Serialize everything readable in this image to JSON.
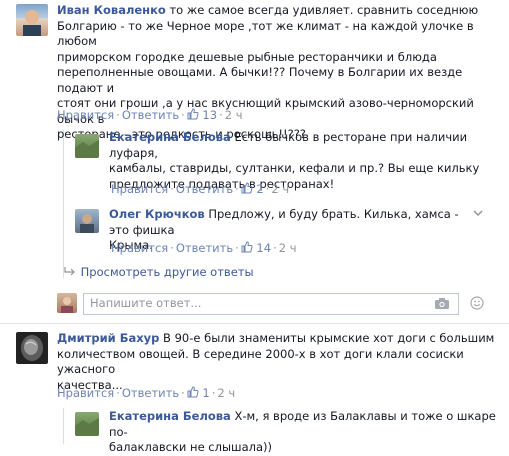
{
  "comments": [
    {
      "author": "Иван Коваленко",
      "lines": [
        " то же самое всегда удивляет. сравнить соседнюю",
        "Болгарию - то же Черное море ,тот же климат - на каждой улочке в любом",
        "приморском городке дешевые рыбные ресторанчики и блюда",
        "переполненные овощами. А бычки!?? Почему в Болгарии их везде подают и",
        "стоят они гроши ,а у нас вкуснющий крымский азово-черноморский бычок в",
        "ресторане - это редкость и роскошь!!???"
      ],
      "reply_label": "Нравится",
      "reply_action": "Ответить",
      "likes": "13",
      "time": "2 ч"
    },
    {
      "author": "Екатерина Белова",
      "lines": [
        " Есть бычков в ресторане при наличии луфаря,",
        "камбалы, ставриды, султанки, кефали и пр.? Вы еще кильку",
        "предложите подавать в ресторанах!"
      ],
      "reply_label": "Нравится",
      "reply_action": "Ответить",
      "likes": "2",
      "time": "2 ч"
    },
    {
      "author": "Олег Крючков",
      "lines": [
        " Предложу, и буду брать. Килька, хамса - это фишка",
        "Крыма."
      ],
      "reply_label": "Нравится",
      "reply_action": "Ответить",
      "likes": "14",
      "time": "2 ч"
    },
    {
      "author": "Дмитрий Бахур",
      "lines": [
        " В 90-е были знамениты крымские хот доги с большим",
        "количеством овощей. В середине 2000-х в хот доги клали сосиски ужасного",
        "качества..."
      ],
      "reply_label": "Нравится",
      "reply_action": "Ответить",
      "likes": "1",
      "time": "2 ч"
    },
    {
      "author": "Екатерина Белова",
      "lines": [
        " Х-м, я вроде из Балаклавы и тоже о шкаре по-",
        "балаклавски не слышала))"
      ]
    }
  ],
  "more_replies": "Просмотреть другие ответы",
  "reply_placeholder": "Напишите ответ...",
  "icons": {
    "like": "thumbs-up-icon",
    "camera": "camera-icon",
    "more": "chevron-down-icon",
    "reply_arrow": "reply-arrow-icon"
  },
  "colors": {
    "link": "#3b5998",
    "action": "#6d84b4",
    "meta": "#90949c"
  }
}
